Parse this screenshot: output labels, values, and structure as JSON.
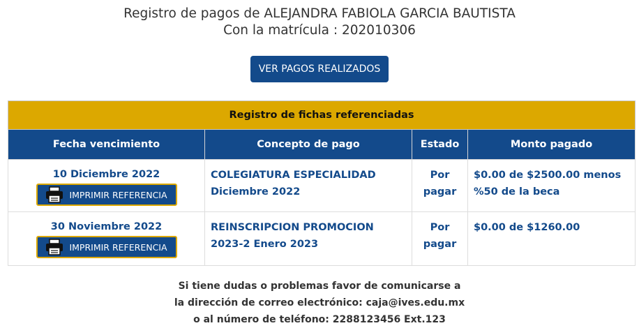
{
  "header": {
    "line1_prefix": "Registro de pagos de ",
    "student_name": "ALEJANDRA FABIOLA GARCIA BAUTISTA",
    "line2_prefix": "Con la matrícula : ",
    "enrollment_id": "202010306"
  },
  "view_payments_button": "VER PAGOS REALIZADOS",
  "table": {
    "caption": "Registro de fichas referenciadas",
    "columns": [
      "Fecha vencimiento",
      "Concepto de pago",
      "Estado",
      "Monto pagado"
    ],
    "rows": [
      {
        "due_date": "10 Diciembre 2022",
        "print_label": "IMPRIMIR REFERENCIA",
        "concept": "COLEGIATURA ESPECIALIDAD Diciembre 2022",
        "status": "Por pagar",
        "amount": "$0.00 de $2500.00 menos %50 de la beca"
      },
      {
        "due_date": "30 Noviembre 2022",
        "print_label": "IMPRIMIR REFERENCIA",
        "concept": "REINSCRIPCION PROMOCION 2023-2 Enero 2023",
        "status": "Por pagar",
        "amount": "$0.00 de $1260.00"
      }
    ]
  },
  "footer": {
    "line1": "Si tiene dudas o problemas favor de comunicarse a",
    "line2": "la dirección de correo electrónico: caja@ives.edu.mx",
    "line3": "o al número de teléfono: 2288123456 Ext.123"
  },
  "colors": {
    "primary_blue": "#134a8b",
    "accent_gold": "#dca800"
  },
  "icons": [
    "printer-icon"
  ]
}
